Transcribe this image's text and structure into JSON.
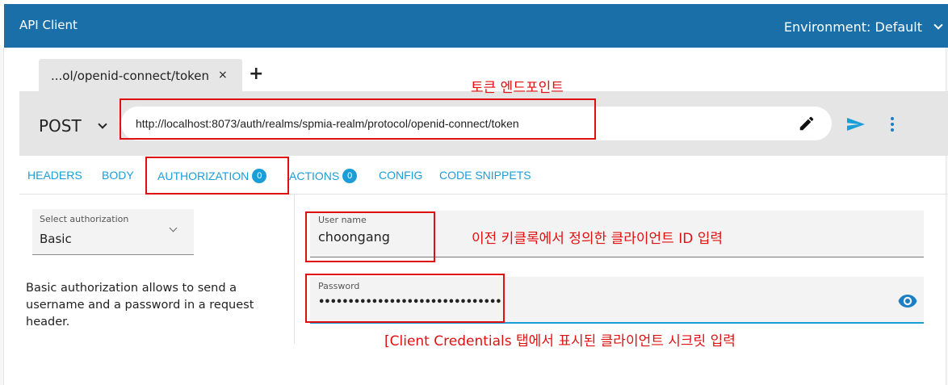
{
  "app": {
    "title": "API Client",
    "environment_label": "Environment: Default"
  },
  "tabs": [
    {
      "label": "...ol/openid-connect/token",
      "close": "×"
    }
  ],
  "add_tab": "+",
  "request": {
    "method": "POST",
    "url": "http://localhost:8073/auth/realms/spmia-realm/protocol/openid-connect/token"
  },
  "nav": [
    {
      "label": "HEADERS"
    },
    {
      "label": "BODY"
    },
    {
      "label": "AUTHORIZATION",
      "badge": "0"
    },
    {
      "label": "ACTIONS",
      "badge": "0"
    },
    {
      "label": "CONFIG"
    },
    {
      "label": "CODE SNIPPETS"
    }
  ],
  "auth": {
    "select_label": "Select authorization",
    "select_value": "Basic",
    "description": "Basic authorization allows to send a username and a password in a request header.",
    "username_label": "User name",
    "username_value": "choongang",
    "password_label": "Password",
    "password_value": "•••••••••••••••••••••••••••••••"
  },
  "annotations": {
    "token_endpoint": "토큰 엔드포인트",
    "client_id": "이전 키클록에서 정의한 클라이언트 ID 입력",
    "client_secret": "[Client Credentials 탭에서 표시된 클라이언트 시크릿 입력"
  },
  "colors": {
    "header": "#1a6fa8",
    "accent": "#1b9ed8",
    "annotation": "#e01010"
  }
}
